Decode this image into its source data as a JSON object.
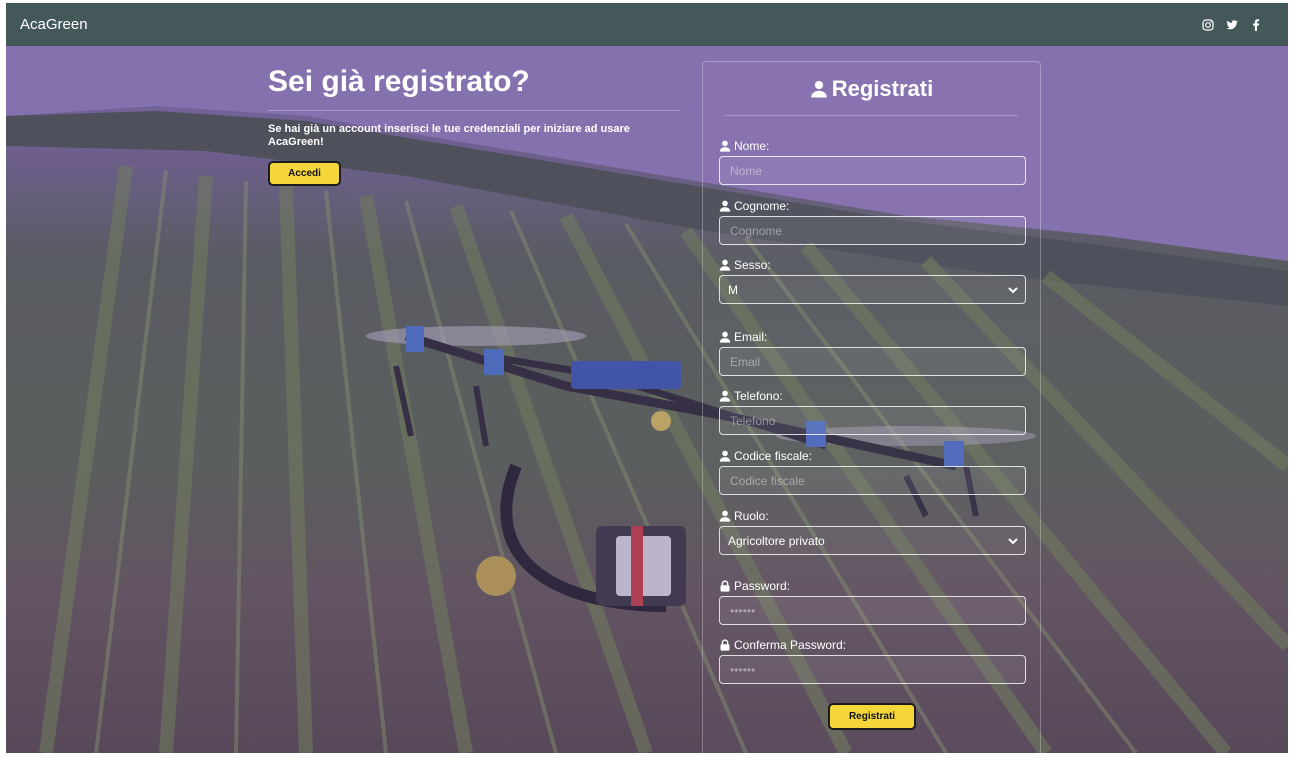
{
  "navbar": {
    "brand": "AcaGreen",
    "social_icons": [
      "instagram-icon",
      "twitter-icon",
      "facebook-icon"
    ]
  },
  "login": {
    "heading": "Sei già registrato?",
    "description": "Se hai già un account inserisci le tue credenziali per iniziare ad usare AcaGreen!",
    "button_label": "Accedi"
  },
  "register": {
    "title": "Registrati",
    "fields": {
      "nome": {
        "label": "Nome:",
        "placeholder": "Nome",
        "icon": "user-icon"
      },
      "cognome": {
        "label": "Cognome:",
        "placeholder": "Cognome",
        "icon": "user-icon"
      },
      "sesso": {
        "label": "Sesso:",
        "value": "M",
        "icon": "user-icon"
      },
      "email": {
        "label": "Email:",
        "placeholder": "Email",
        "icon": "user-icon"
      },
      "telefono": {
        "label": "Telefono:",
        "placeholder": "Telefono",
        "icon": "user-icon"
      },
      "codice_fiscale": {
        "label": "Codice fiscale:",
        "placeholder": "Codice fiscale",
        "icon": "user-icon"
      },
      "ruolo": {
        "label": "Ruolo:",
        "value": "Agricoltore privato",
        "icon": "user-icon"
      },
      "password": {
        "label": "Password:",
        "placeholder": "••••••",
        "icon": "lock-icon"
      },
      "conferma_password": {
        "label": "Conferma Password:",
        "placeholder": "••••••",
        "icon": "lock-icon"
      }
    },
    "submit_label": "Registrati"
  },
  "colors": {
    "navbar": "#44585a",
    "button_yellow": "#f4d53a",
    "overlay_purple": "#7860aa"
  }
}
